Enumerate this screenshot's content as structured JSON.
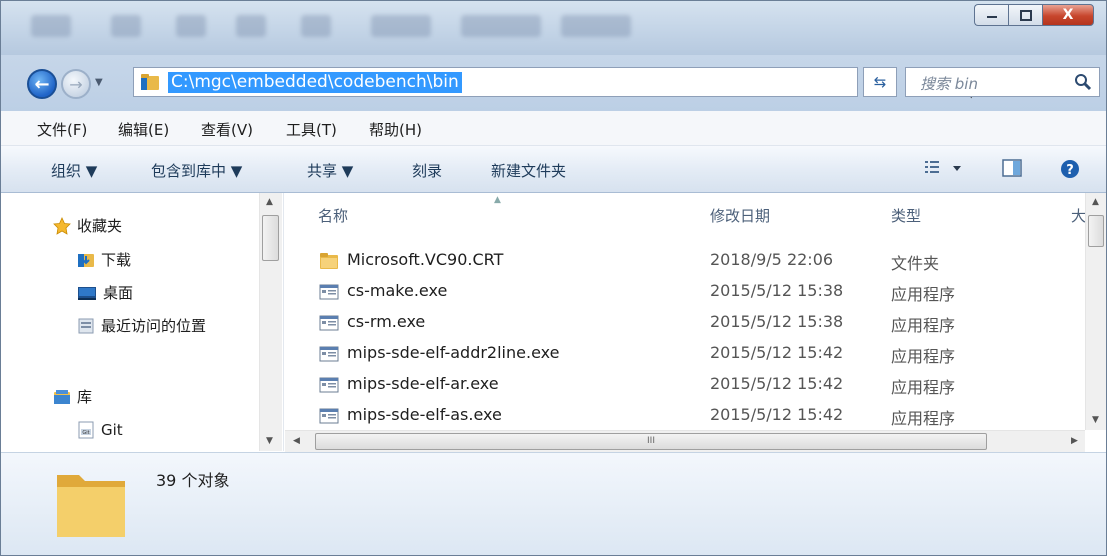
{
  "window": {
    "minimize": "minimize",
    "maximize": "maximize",
    "close": "X"
  },
  "address": {
    "path": "C:\\mgc\\embedded\\codebench\\bin",
    "search_placeholder": "搜索 bin"
  },
  "menu": [
    "文件(F)",
    "编辑(E)",
    "查看(V)",
    "工具(T)",
    "帮助(H)"
  ],
  "commands": {
    "organize": "组织 ▼",
    "include_library": "包含到库中 ▼",
    "share": "共享 ▼",
    "burn": "刻录",
    "new_folder": "新建文件夹"
  },
  "nav": {
    "favorites": "收藏夹",
    "downloads": "下载",
    "desktop": "桌面",
    "recent": "最近访问的位置",
    "libraries": "库",
    "git": "Git"
  },
  "columns": {
    "name": "名称",
    "date": "修改日期",
    "type": "类型",
    "size": "大"
  },
  "files": [
    {
      "name": "Microsoft.VC90.CRT",
      "date": "2018/9/5 22:06",
      "type": "文件夹",
      "kind": "folder"
    },
    {
      "name": "cs-make.exe",
      "date": "2015/5/12 15:38",
      "type": "应用程序",
      "kind": "exe"
    },
    {
      "name": "cs-rm.exe",
      "date": "2015/5/12 15:38",
      "type": "应用程序",
      "kind": "exe"
    },
    {
      "name": "mips-sde-elf-addr2line.exe",
      "date": "2015/5/12 15:42",
      "type": "应用程序",
      "kind": "exe"
    },
    {
      "name": "mips-sde-elf-ar.exe",
      "date": "2015/5/12 15:42",
      "type": "应用程序",
      "kind": "exe"
    },
    {
      "name": "mips-sde-elf-as.exe",
      "date": "2015/5/12 15:42",
      "type": "应用程序",
      "kind": "exe"
    }
  ],
  "status": {
    "count": "39 个对象"
  },
  "hscroll_glyph": "III"
}
